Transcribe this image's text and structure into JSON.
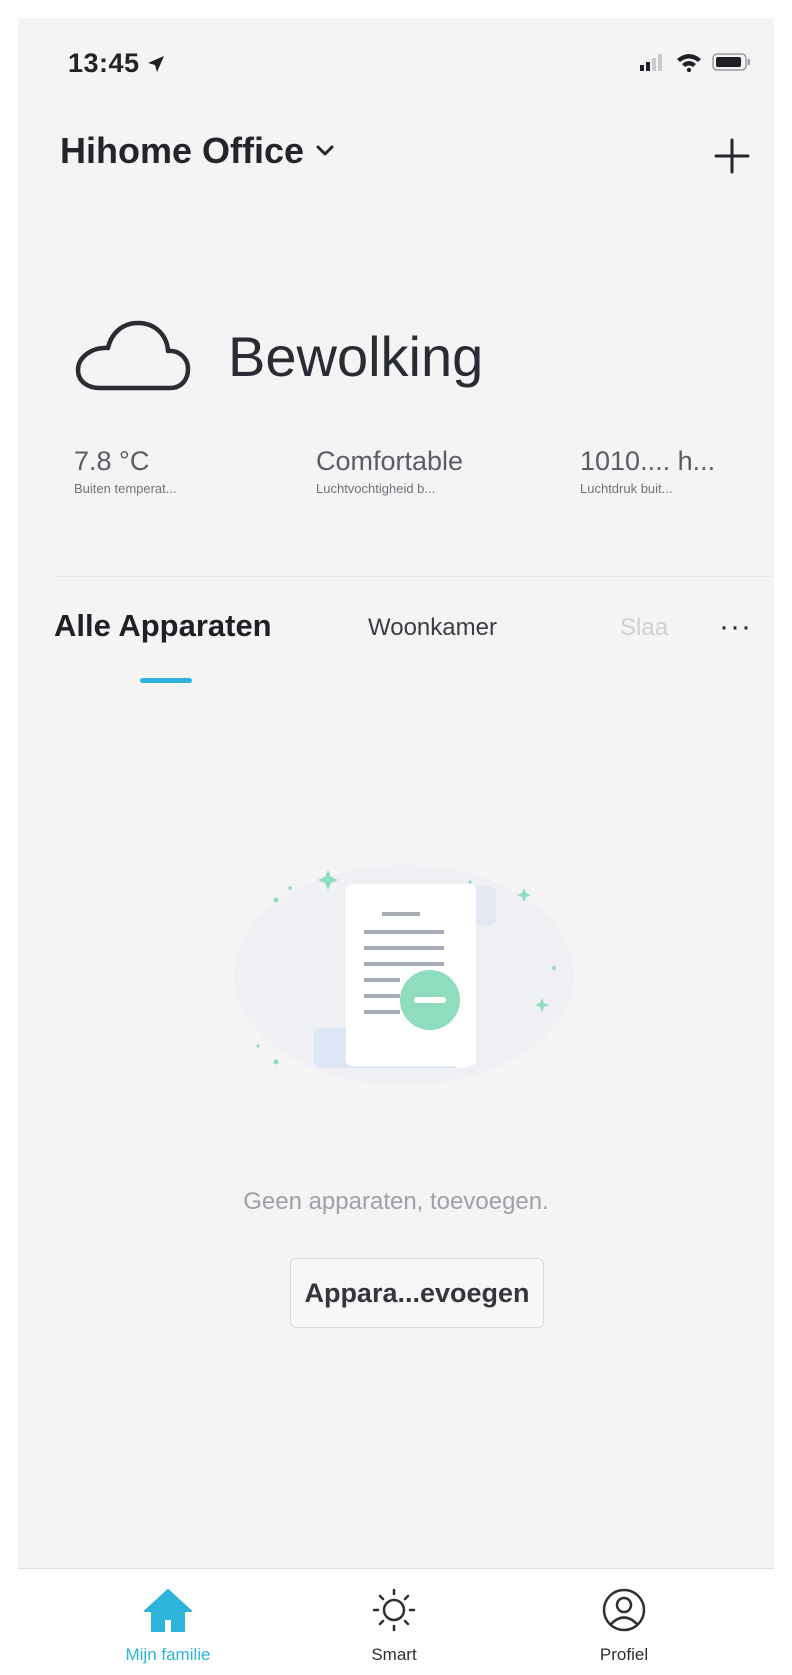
{
  "status_bar": {
    "time": "13:45",
    "icons": [
      "location-arrow-icon",
      "signal-icon",
      "wifi-icon",
      "battery-icon"
    ]
  },
  "header": {
    "home_name": "Hihome Office",
    "dropdown_icon": "chevron-down-icon",
    "add_icon": "plus-icon"
  },
  "weather": {
    "icon": "cloud-icon",
    "condition": "Bewolking",
    "stats": [
      {
        "value": "7.8 °C",
        "label": "Buiten temperat..."
      },
      {
        "value": "Comfortable",
        "label": "Luchtvochtigheid b..."
      },
      {
        "value": "1010.... h...",
        "label": "Luchtdruk buit..."
      }
    ]
  },
  "tabs": {
    "items": [
      "Alle Apparaten",
      "Woonkamer",
      "Slaa"
    ],
    "active_index": 0,
    "more_label": "···"
  },
  "empty_state": {
    "illustration_icon": "empty-document-icon",
    "message": "Geen apparaten, toevoegen.",
    "button_label": "Appara...evoegen"
  },
  "tab_bar": {
    "items": [
      {
        "label": "Mijn familie",
        "icon": "home-icon",
        "active": true
      },
      {
        "label": "Smart",
        "icon": "sun-icon",
        "active": false
      },
      {
        "label": "Profiel",
        "icon": "profile-icon",
        "active": false
      }
    ]
  },
  "colors": {
    "accent": "#2db3dc",
    "background": "#f4f4f5",
    "illustration_green": "#8fdcbf"
  }
}
